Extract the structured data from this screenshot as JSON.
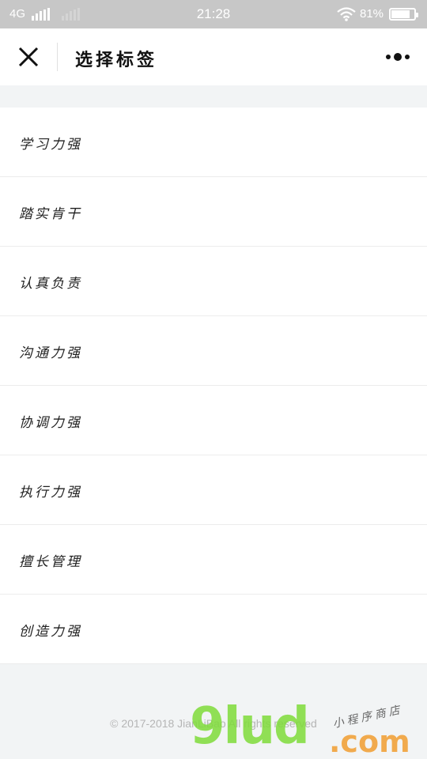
{
  "status_bar": {
    "network": "4G",
    "time": "21:28",
    "battery": "81%",
    "battery_level": 0.81
  },
  "nav": {
    "title": "选择标签"
  },
  "tags": [
    {
      "label": "学习力强"
    },
    {
      "label": "踏实肯干"
    },
    {
      "label": "认真负责"
    },
    {
      "label": "沟通力强"
    },
    {
      "label": "协调力强"
    },
    {
      "label": "执行力强"
    },
    {
      "label": "擅长管理"
    },
    {
      "label": "创造力强"
    }
  ],
  "footer": {
    "copyright": "© 2017-2018 JianLiBao All rights reserved"
  },
  "watermark": {
    "brand": "9lud",
    "domain": ".com",
    "slogan": "小程序商店"
  }
}
